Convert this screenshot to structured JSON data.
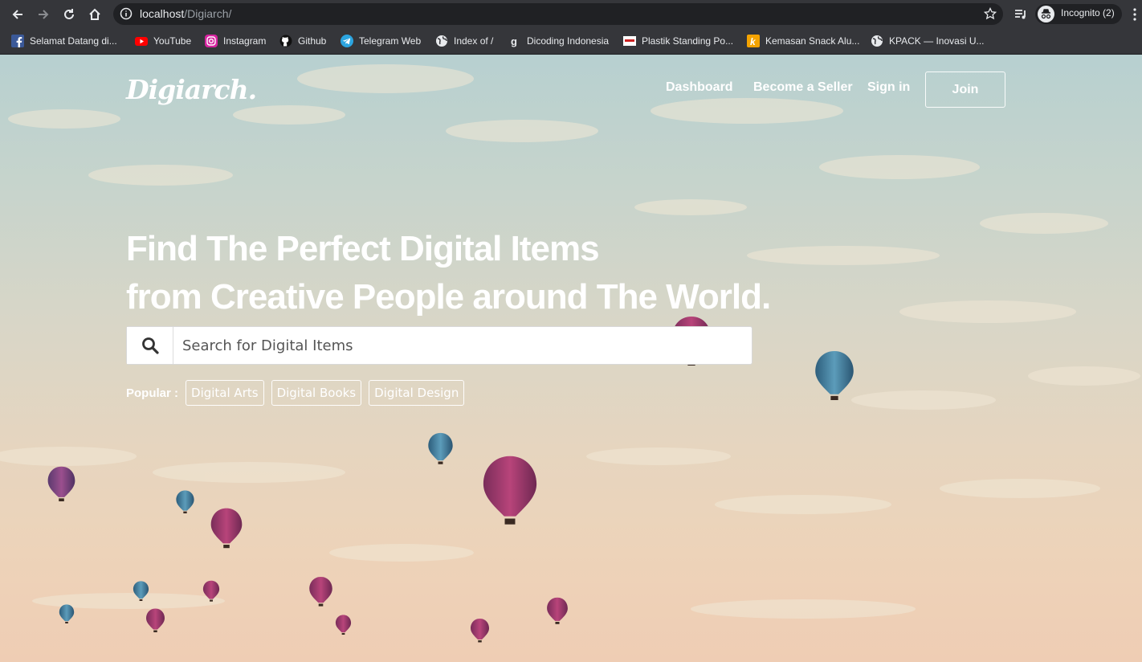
{
  "browser": {
    "url_host": "localhost",
    "url_path": "/Digiarch/",
    "incognito_label": "Incognito (2)",
    "bookmarks": [
      {
        "label": "Selamat Datang di...",
        "icon": "facebook-icon"
      },
      {
        "label": "YouTube",
        "icon": "youtube-icon"
      },
      {
        "label": "Instagram",
        "icon": "instagram-icon"
      },
      {
        "label": "Github",
        "icon": "github-icon"
      },
      {
        "label": "Telegram Web",
        "icon": "telegram-icon"
      },
      {
        "label": "Index of /",
        "icon": "globe-icon"
      },
      {
        "label": "Dicoding Indonesia",
        "icon": "dicoding-icon"
      },
      {
        "label": "Plastik Standing Po...",
        "icon": "site-favicon"
      },
      {
        "label": "Kemasan Snack Alu...",
        "icon": "k-favicon"
      },
      {
        "label": "KPACK — Inovasi U...",
        "icon": "globe-icon"
      }
    ]
  },
  "header": {
    "brand": "Digiarch.",
    "nav": {
      "dashboard": "Dashboard",
      "become_seller": "Become a Seller",
      "sign_in": "Sign in",
      "join": "Join"
    }
  },
  "hero": {
    "title_line1": "Find The Perfect Digital Items",
    "title_line2": "from Creative People around The World.",
    "search_placeholder": "Search for Digital Items",
    "popular_label": "Popular :",
    "tags": [
      "Digital Arts",
      "Digital Books",
      "Digital Design"
    ]
  },
  "colors": {
    "chrome_bg": "#35363a",
    "omnibox_bg": "#202124",
    "balloon_pink": "#a0386a",
    "balloon_blue": "#3a7d9e"
  }
}
